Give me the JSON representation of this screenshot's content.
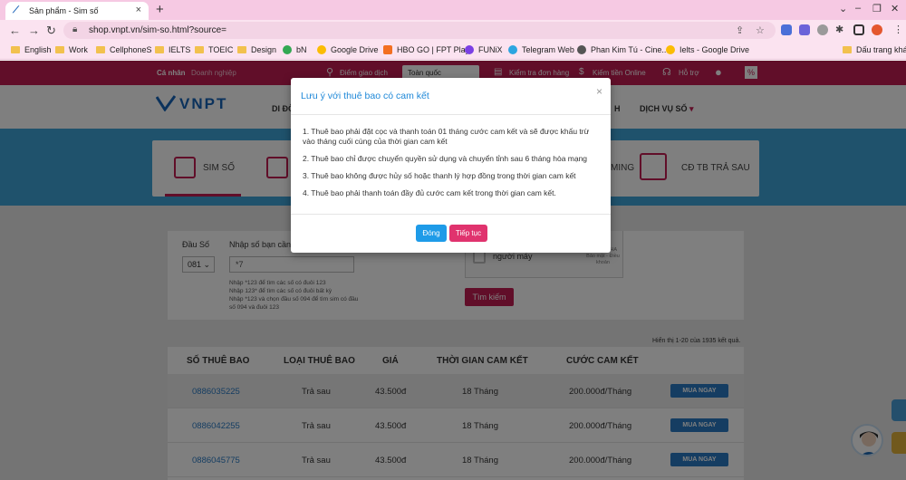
{
  "browser": {
    "tab_title": "Sản phẩm - Sim số",
    "url": "shop.vnpt.vn/sim-so.html?source=",
    "bookmarks": [
      {
        "label": "English",
        "type": "folder"
      },
      {
        "label": "Work",
        "type": "folder"
      },
      {
        "label": "CellphoneS",
        "type": "folder"
      },
      {
        "label": "IELTS",
        "type": "folder"
      },
      {
        "label": "TOEIC",
        "type": "folder"
      },
      {
        "label": "Design",
        "type": "folder"
      },
      {
        "label": "bN",
        "type": "site"
      },
      {
        "label": "Google Drive",
        "type": "site"
      },
      {
        "label": "HBO GO | FPT Play",
        "type": "site"
      },
      {
        "label": "FUNiX",
        "type": "site"
      },
      {
        "label": "Telegram Web",
        "type": "site"
      },
      {
        "label": "Phan Kim Tú - Cine...",
        "type": "site"
      },
      {
        "label": "Ielts - Google Drive",
        "type": "site"
      },
      {
        "label": "Dấu trang khác",
        "type": "folder"
      }
    ]
  },
  "topbar": {
    "personal": "Cá nhân",
    "business": "Doanh nghiệp",
    "store_location": "Điểm giao dịch",
    "region": "Toàn quốc",
    "check_order": "Kiểm tra đơn hàng",
    "earn_online": "Kiếm tiền Online",
    "support": "Hỗ trợ"
  },
  "header": {
    "logo": "VNPT",
    "menu_left": "DI ĐỘ",
    "menu_h": "H",
    "menu_number": "DỊCH VỤ SỐ"
  },
  "categories": [
    {
      "label": "SIM SỐ",
      "active": true
    },
    {
      "label": "MING",
      "active": false
    },
    {
      "label": "CĐ TB TRẢ SAU",
      "active": false
    }
  ],
  "search": {
    "prefix_label": "Đầu Số",
    "prefix_value": "081",
    "number_label": "Nhập số bạn cần",
    "number_value": "*7",
    "hints": [
      "Nhập *123 để tìm các số có đuôi 123",
      "Nhập 123* để tìm các số có đuôi bất kỳ",
      "Nhập *123 và chọn đầu số 094 để tìm sim có đầu số 094 và đuôi 123"
    ],
    "captcha_text": "Tôi không phải là người máy",
    "captcha_brand": "reCAPTCHA",
    "captcha_terms": "Bảo mật - Điều khoản",
    "button": "Tìm kiếm"
  },
  "results": {
    "count_text": "Hiển thị 1-20 của 1935 kết quả.",
    "headers": [
      "SỐ THUÊ BAO",
      "LOẠI THUÊ BAO",
      "GIÁ",
      "THỜI GIAN CAM KẾT",
      "CƯỚC CAM KẾT"
    ],
    "rows": [
      {
        "number": "0886035225",
        "type": "Trả sau",
        "price": "43.500đ",
        "term": "18 Tháng",
        "fee": "200.000đ/Tháng",
        "button": "MUA NGAY"
      },
      {
        "number": "0886042255",
        "type": "Trả sau",
        "price": "43.500đ",
        "term": "18 Tháng",
        "fee": "200.000đ/Tháng",
        "button": "MUA NGAY"
      },
      {
        "number": "0886045775",
        "type": "Trả sau",
        "price": "43.500đ",
        "term": "18 Tháng",
        "fee": "200.000đ/Tháng",
        "button": "MUA NGAY"
      }
    ]
  },
  "modal": {
    "title": "Lưu ý với thuê bao có cam kết",
    "items": [
      "1. Thuê bao phải đặt cọc và thanh toán 01 tháng cước cam kết và sẽ được khấu trừ vào tháng cuối cùng của thời gian cam kết",
      "2. Thuê bao chỉ được chuyển quyền sử dụng và chuyển tỉnh sau 6 tháng hòa mạng",
      "3. Thuê bao không được hủy số hoặc thanh lý hợp đồng trong thời gian cam kết",
      "4. Thuê bao phải thanh toán đầy đủ cước cam kết trong thời gian cam kết."
    ],
    "close_button": "Đóng",
    "continue_button": "Tiếp tục"
  },
  "colors": {
    "brand": "#c21d53",
    "link": "#2b7bc4",
    "modal_title": "#1e88d8",
    "close_btn": "#1e9be8",
    "continue_btn": "#e0336e"
  }
}
